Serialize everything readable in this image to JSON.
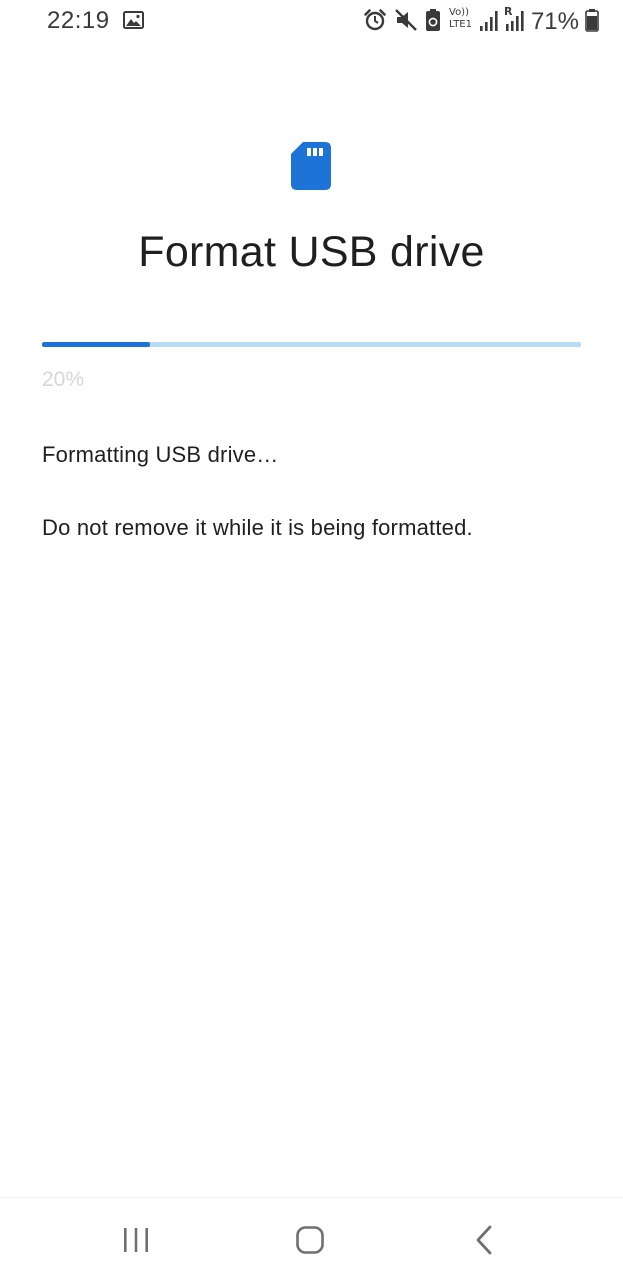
{
  "status_bar": {
    "time": "22:19",
    "battery_percent": "71%",
    "icons": [
      "gallery-icon",
      "alarm-icon",
      "mute-icon",
      "battery-saver-icon",
      "volte-lte-icon",
      "signal-icon",
      "roaming-signal-icon",
      "battery-icon"
    ],
    "volte_label_top": "Vo))",
    "volte_label_bottom": "LTE1",
    "roaming_label": "R"
  },
  "main": {
    "icon": "sd-card-icon",
    "title": "Format USB drive",
    "progress": {
      "fraction": 0.2,
      "label": "20%"
    },
    "message_primary": "Formatting USB drive…",
    "message_secondary": "Do not remove it while it is being formatted."
  },
  "nav_bar": {
    "buttons": [
      "recents-icon",
      "home-icon",
      "back-icon"
    ]
  },
  "colors": {
    "accent": "#1e73d6",
    "progress_track": "#b9dcf6",
    "text_primary": "#1f1f1f",
    "text_disabled": "#d6d6d6",
    "status_icon": "#3a3a3a"
  }
}
